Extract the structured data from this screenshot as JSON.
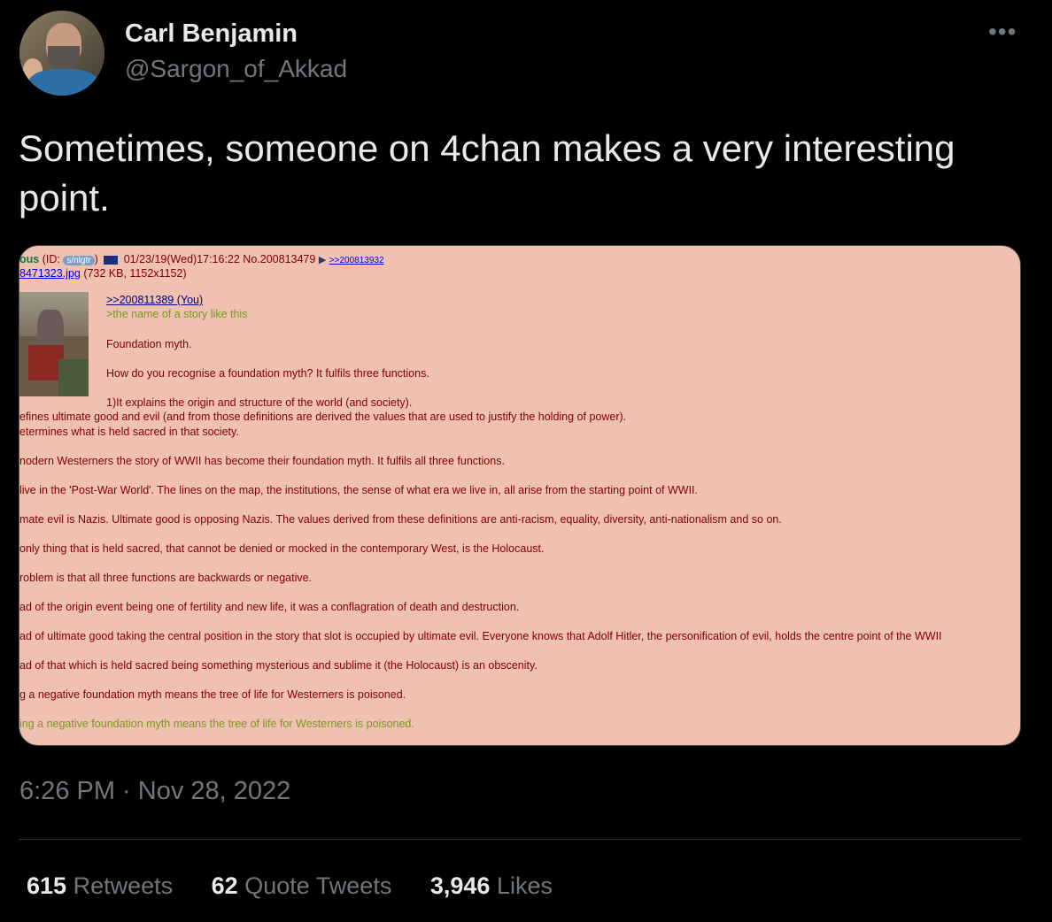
{
  "author": {
    "name": "Carl Benjamin",
    "handle": "@Sargon_of_Akkad"
  },
  "more_label": "•••",
  "tweet_text": "Sometimes, someone on 4chan makes a very interesting point.",
  "media": {
    "header_name": "ous",
    "header_id_prefix": "(ID:",
    "header_id_badge": "s/nlgtr",
    "header_id_suffix": ")",
    "header_date": "01/23/19(Wed)17:16:22 No.200813479",
    "header_arrow": "▶",
    "header_reply_link": ">>200813932",
    "file_link": "8471323.jpg",
    "file_info": "(732 KB, 1152x1152)",
    "quote_link": ">>200811389 (You)",
    "greentext_1": ">the name of a story like this",
    "lines": [
      "Foundation myth.",
      "How do you recognise a foundation myth? It fulfils three functions.",
      "1)It explains the origin and structure of the world (and society).",
      "efines ultimate good and evil (and from those definitions are derived the values that are used to justify the holding of power).",
      "etermines what is held sacred in that society.",
      "nodern Westerners the story of WWII has become their foundation myth. It fulfils all three functions.",
      " live in the 'Post-War World'. The lines on the map, the institutions, the sense of what era we live in, all arise from the starting point of WWII.",
      "mate evil is Nazis. Ultimate good is opposing Nazis. The values derived from these definitions are anti-racism, equality, diversity, anti-nationalism and so on.",
      " only thing that is held sacred, that cannot be denied or mocked in the contemporary West, is the Holocaust.",
      "roblem is that all three functions are backwards or negative.",
      "ad of the origin event being one of fertility and new life, it was a conflagration of death and destruction.",
      "ad of ultimate good taking the central position in the story that slot is occupied by ultimate evil. Everyone knows that Adolf Hitler, the personification of evil, holds the centre point of the WWII",
      "ad of that which is held sacred being something mysterious and sublime it (the Holocaust) is an obscenity.",
      "g a negative foundation myth means the tree of life for Westerners is poisoned."
    ],
    "greentext_2": "ing a negative foundation myth means the tree of life for Westerners is poisoned."
  },
  "timestamp": "6:26 PM · Nov 28, 2022",
  "stats": {
    "retweets_count": "615",
    "retweets_label": "Retweets",
    "quotes_count": "62",
    "quotes_label": "Quote Tweets",
    "likes_count": "3,946",
    "likes_label": "Likes"
  },
  "colors": {
    "background": "#000000",
    "text_primary": "#e7e9ea",
    "text_secondary": "#71767b",
    "post_background": "#f0c0b0",
    "post_text": "#800000",
    "greentext": "#789922"
  }
}
